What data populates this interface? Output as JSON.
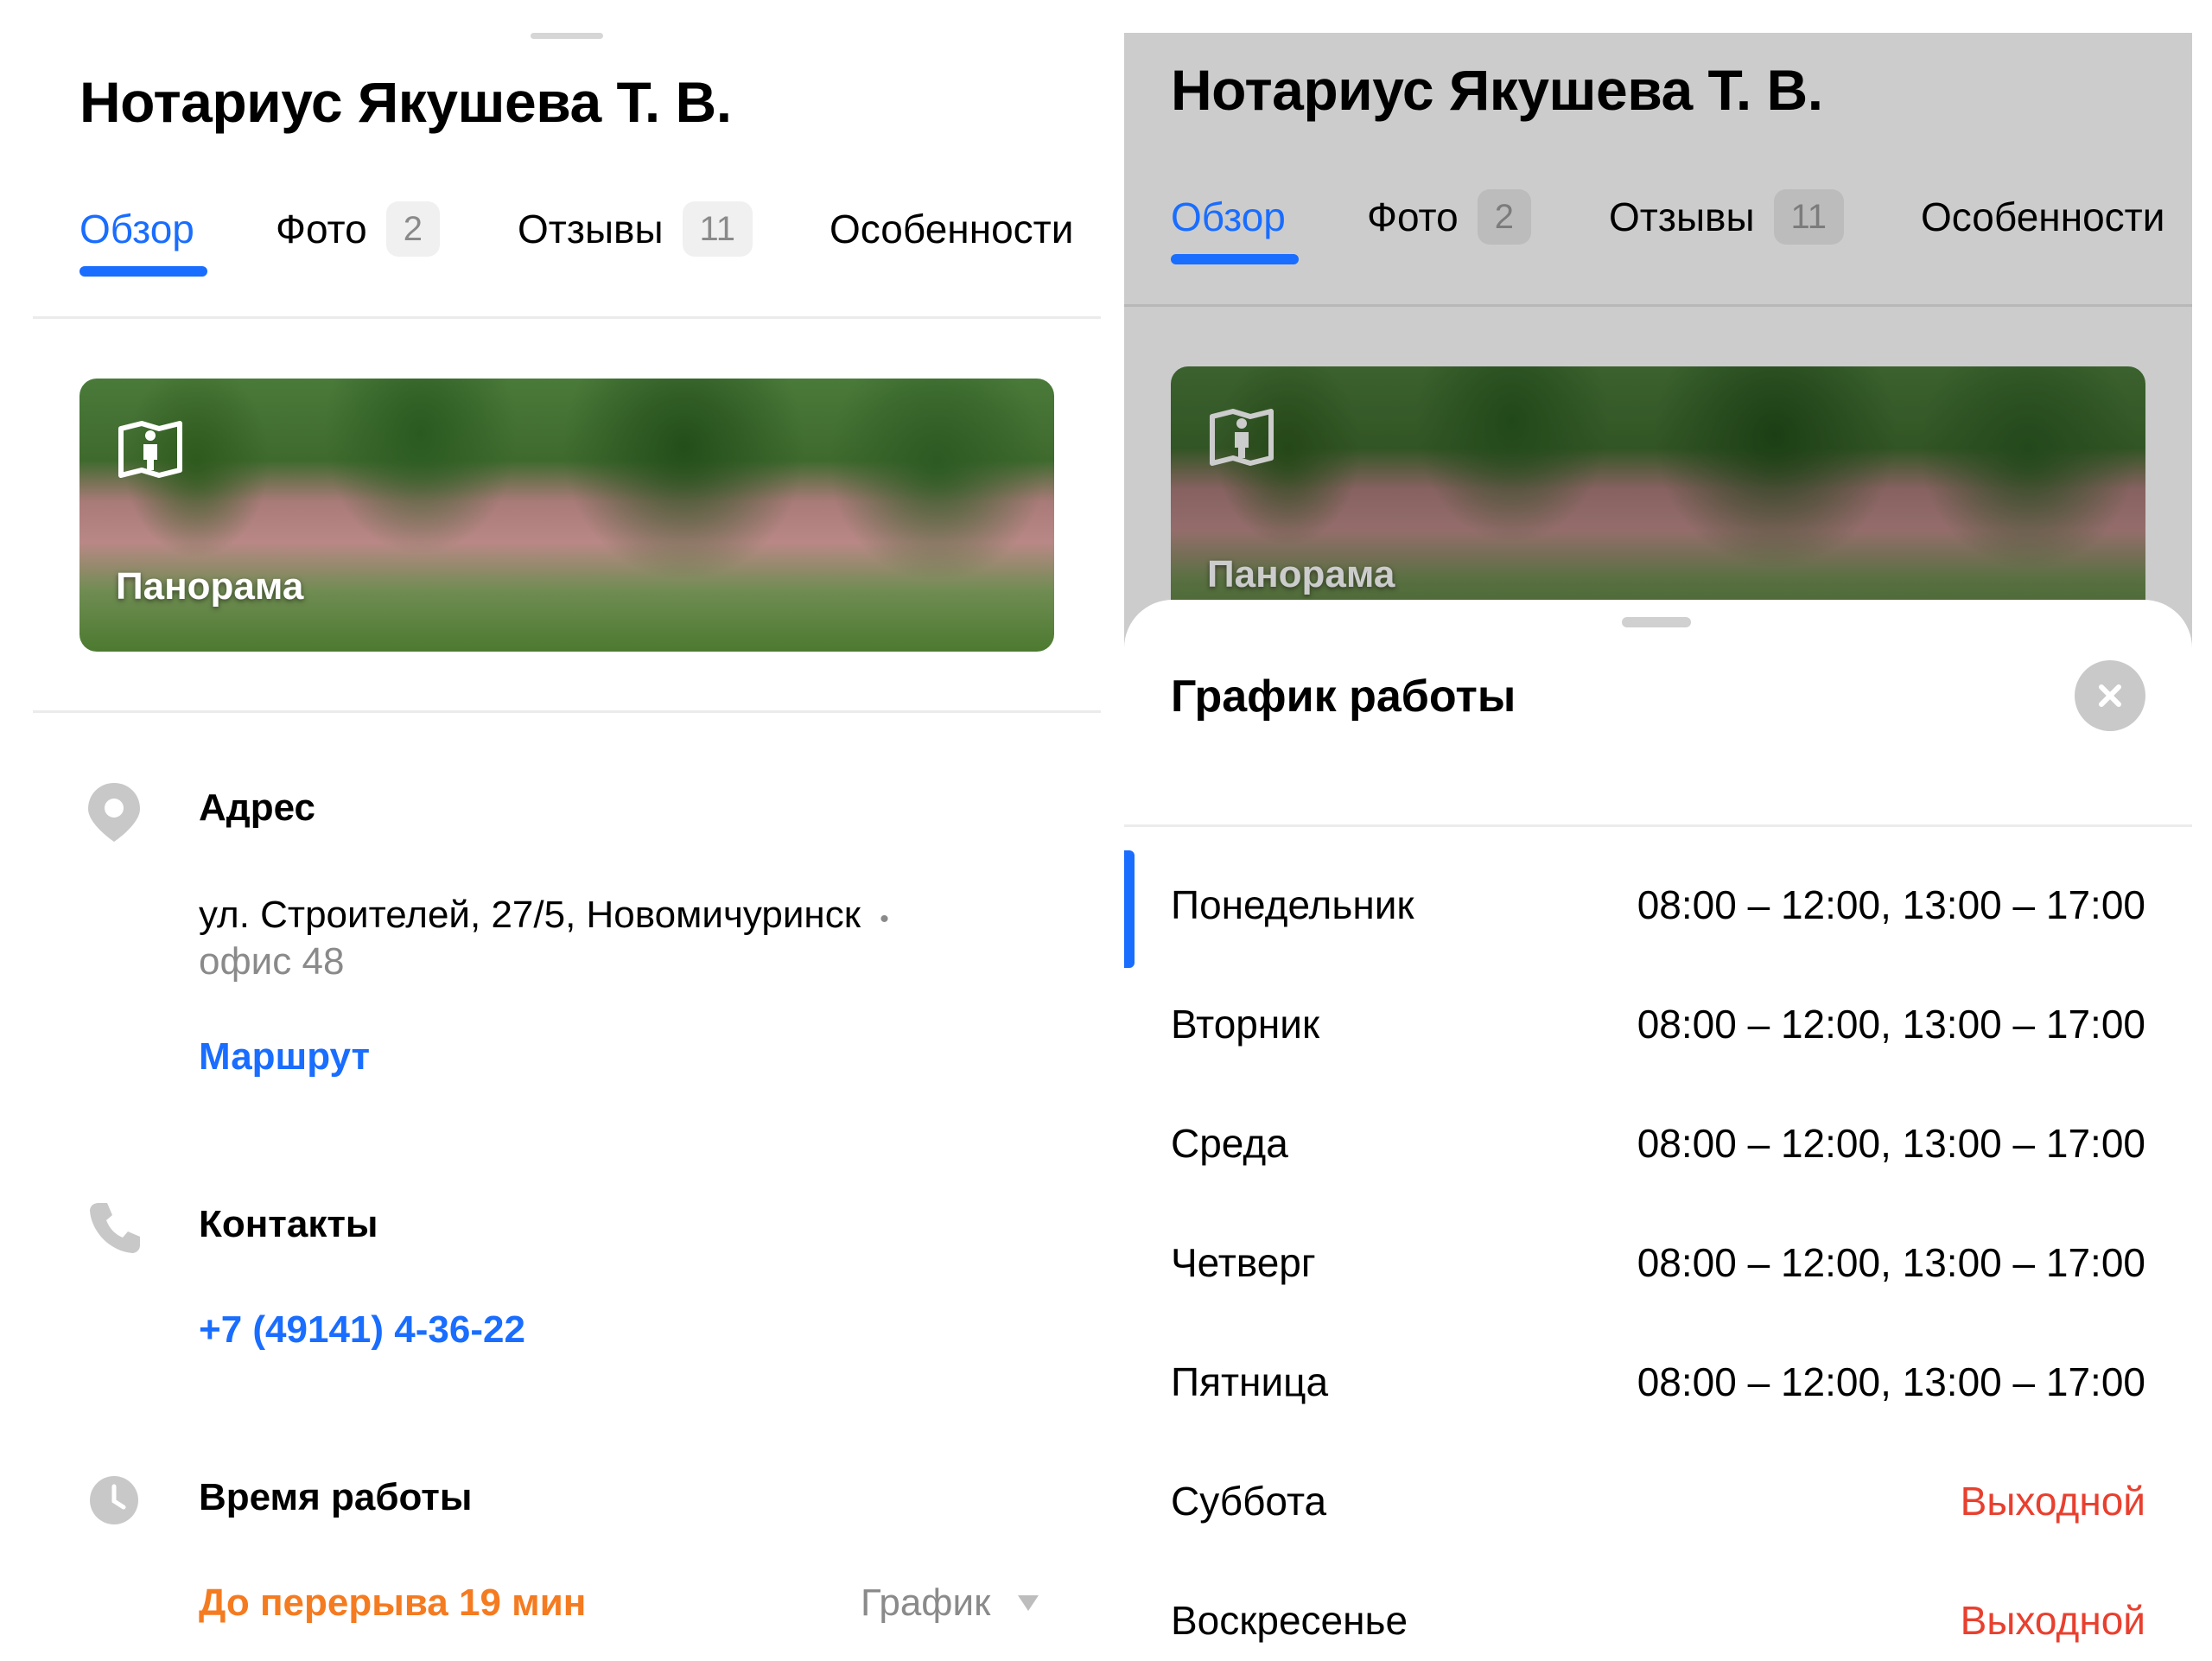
{
  "left_panel": {
    "title": "Нотариус Якушева Т. В.",
    "tabs": [
      {
        "label": "Обзор",
        "active": true
      },
      {
        "label": "Фото",
        "count": "2"
      },
      {
        "label": "Отзывы",
        "count": "11"
      },
      {
        "label": "Особенности"
      }
    ],
    "panorama_label": "Панорама",
    "address": {
      "title": "Адрес",
      "line1": "ул. Строителей, 27/5, Новомичуринск",
      "line2": "офис 48",
      "route_link": "Маршрут"
    },
    "contacts": {
      "title": "Контакты",
      "phone": "+7 (49141) 4-36-22"
    },
    "hours": {
      "title": "Время работы",
      "status": "До перерыва 19 мин",
      "schedule_link": "График"
    }
  },
  "right_panel": {
    "title": "Нотариус Якушева Т. В.",
    "tabs": [
      {
        "label": "Обзор",
        "active": true
      },
      {
        "label": "Фото",
        "count": "2"
      },
      {
        "label": "Отзывы",
        "count": "11"
      },
      {
        "label": "Особенности"
      }
    ],
    "panorama_label": "Панорама",
    "sheet": {
      "title": "График работы",
      "days": [
        {
          "day": "Понедельник",
          "hours": "08:00 – 12:00, 13:00 – 17:00",
          "selected": true
        },
        {
          "day": "Вторник",
          "hours": "08:00 – 12:00, 13:00 – 17:00"
        },
        {
          "day": "Среда",
          "hours": "08:00 – 12:00, 13:00 – 17:00"
        },
        {
          "day": "Четверг",
          "hours": "08:00 – 12:00, 13:00 – 17:00"
        },
        {
          "day": "Пятница",
          "hours": "08:00 – 12:00, 13:00 – 17:00"
        },
        {
          "day": "Суббота",
          "hours": "Выходной",
          "day_off": true
        },
        {
          "day": "Воскресенье",
          "hours": "Выходной",
          "day_off": true
        }
      ]
    }
  },
  "colors": {
    "accent": "#196dff",
    "status_orange": "#f57b20",
    "day_off_red": "#e8402f",
    "dim_overlay": "#cccccc"
  },
  "icons": [
    "panorama-icon",
    "location-pin-icon",
    "phone-icon",
    "clock-icon",
    "dropdown-triangle-icon",
    "close-icon"
  ]
}
